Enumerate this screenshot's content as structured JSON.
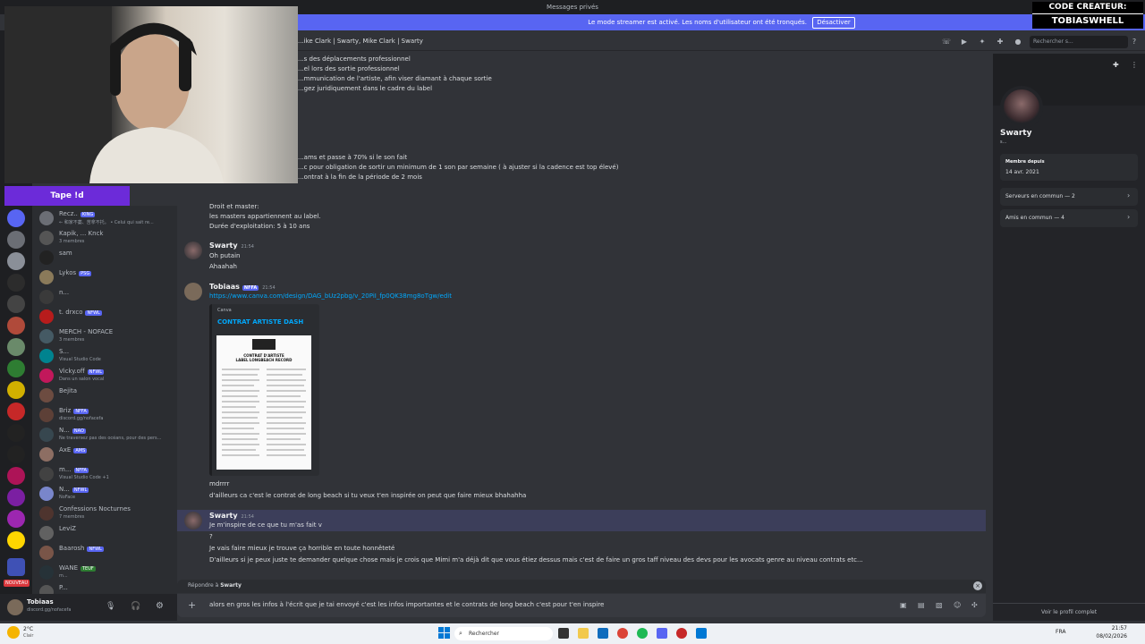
{
  "window": {
    "title": "Messages privés"
  },
  "streamer_banner": {
    "text": "Le mode streamer est activé. Les noms d'utilisateur ont été tronqués.",
    "button": "Désactiver"
  },
  "overlay": {
    "tape_id": "Tape !d",
    "code_line1": "CODE CREATEUR:",
    "code_line2": "TOBIASWHELL"
  },
  "header": {
    "title": "...ike Clark | Swarty, Mike Clark | Swarty",
    "search_placeholder": "Rechercher s..."
  },
  "dms": [
    {
      "name": "Recz..",
      "badge": "KING",
      "sub": "← 和家不萎、苦拿不托。 • Celui qui sait re..."
    },
    {
      "name": "Kapik, ... Knck",
      "badge": "",
      "sub": "3 membres"
    },
    {
      "name": "sam",
      "badge": "",
      "sub": ""
    },
    {
      "name": "Lykos",
      "badge": "PSG",
      "sub": ""
    },
    {
      "name": "n...",
      "badge": "",
      "sub": ""
    },
    {
      "name": "t. drxco",
      "badge": "NFWL",
      "sub": ""
    },
    {
      "name": "MERCH - NOFACE",
      "badge": "",
      "sub": "3 membres"
    },
    {
      "name": "S...",
      "badge": "",
      "sub": "Visual Studio Code"
    },
    {
      "name": "Vicky.off",
      "badge": "NFWL",
      "sub": "Dans un salon vocal"
    },
    {
      "name": "Bejita",
      "badge": "",
      "sub": ""
    },
    {
      "name": "Briz",
      "badge": "NFFA",
      "sub": "discord.gg/nofacefa"
    },
    {
      "name": "N...",
      "badge": "NAO",
      "sub": "Ne traversez pas des océans, pour des pers..."
    },
    {
      "name": "AxE",
      "badge": "AMS",
      "sub": ""
    },
    {
      "name": "m...",
      "badge": "NFFA",
      "sub": "Visual Studio Code +1"
    },
    {
      "name": "N...",
      "badge": "NFWL",
      "sub": "NoFace"
    },
    {
      "name": "Confessions Nocturnes",
      "badge": "",
      "sub": "7 membres"
    },
    {
      "name": "LeviZ",
      "badge": "",
      "sub": ""
    },
    {
      "name": "Baarosh",
      "badge": "NFWL",
      "sub": ""
    },
    {
      "name": "WANE",
      "badge": "TEUF",
      "sub": "m..."
    },
    {
      "name": "P...",
      "badge": "",
      "sub": ""
    }
  ],
  "user_panel": {
    "name": "Tobiaas",
    "status": "discord.gg/nofacefa",
    "nouveau": "NOUVEAU"
  },
  "contract_lines": [
    "...s des déplacements professionnel",
    "...el lors des sortie professionnel",
    "...mmunication de l'artiste, afin viser diamant à chaque sortie",
    "...gez juridiquement dans le cadre du label",
    "...ams et passe à 70% si le son fait",
    "...c pour obligation de sortir un minimum de 1 son par semaine ( à ajuster si la cadence est top élevé)",
    "...ontrat à la fin de la période de 2 mois"
  ],
  "droit_lines": [
    "Droit et master:",
    "les masters appartiennent au label.",
    "Durée d'exploitation: 5 à 10 ans"
  ],
  "messages": {
    "swarty1": {
      "author": "Swarty",
      "time": "21:54",
      "lines": [
        "Oh putain",
        "Ahaahah"
      ]
    },
    "tobiaas": {
      "author": "Tobiaas",
      "badge": "NFFA",
      "time": "21:54",
      "link": "https://www.canva.com/design/DAG_bUz2pbg/v_20PiI_fp0QK38mg8oTgw/edit",
      "embed_provider": "Canva",
      "embed_title": "CONTRAT ARTISTE DASH",
      "doc_title1": "CONTRAT D'ARTISTE",
      "doc_title2": "LABEL LONGBEACH RECORD",
      "after": [
        "mdrrrr",
        "d'ailleurs ca c'est le contrat de long beach si tu veux t'en inspirée on peut que faire mieux bhahahha"
      ]
    },
    "swarty2": {
      "author": "Swarty",
      "time": "21:54",
      "lines": [
        "Je m'inspire de ce que tu m'as fait v",
        "?",
        "Je vais faire mieux je trouve ça horrible en toute honnêteté",
        "D'ailleurs si je peux juste te demander quelque chose mais je crois que Mimi m'a déjà dit que vous étiez dessus mais c'est de faire un gros taff niveau des devs pour les avocats genre au niveau contrats etc..."
      ]
    }
  },
  "reply": {
    "prefix": "Répondre à",
    "name": "Swarty"
  },
  "composer": {
    "text": "alors en gros les infos à l'écrit que je tai envoyé c'est les infos importantes et le contrats de long beach c'est pour t'en inspire"
  },
  "profile": {
    "name": "Swarty",
    "sub": "s...",
    "member_label": "Membre depuis",
    "member_date": "14 avr. 2021",
    "servers": "Serveurs en commun — 2",
    "friends": "Amis en commun — 4",
    "full_profile": "Voir le profil complet"
  },
  "taskbar": {
    "weather_temp": "2°C",
    "weather_desc": "Clair",
    "search": "Rechercher",
    "lang": "FRA",
    "time": "21:57",
    "date": "08/02/2026"
  },
  "colors": {
    "accent": "#5865f2",
    "bg": "#313338",
    "tape": "#6c2bd9"
  }
}
